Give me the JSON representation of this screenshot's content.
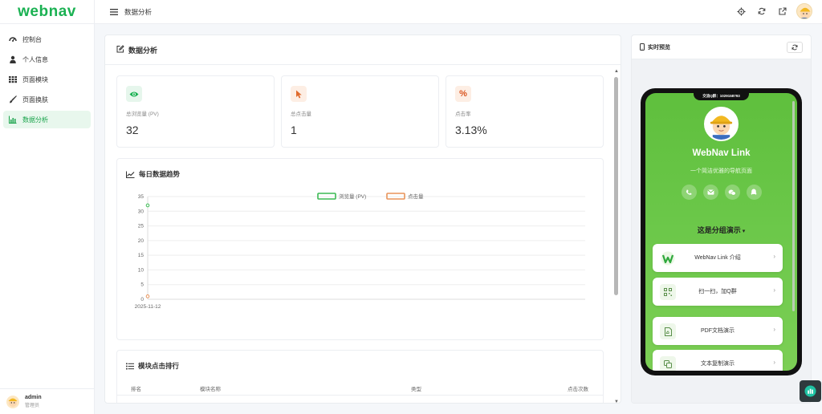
{
  "brand": {
    "logo_text": "webnav",
    "logo_color": "#1ab152"
  },
  "sidebar": {
    "items": [
      {
        "label": "控制台",
        "icon": "dashboard-icon"
      },
      {
        "label": "个人信息",
        "icon": "user-icon"
      },
      {
        "label": "页面模块",
        "icon": "grid-icon"
      },
      {
        "label": "页面换肤",
        "icon": "brush-icon"
      },
      {
        "label": "数据分析",
        "icon": "chart-icon",
        "active": true
      }
    ],
    "user": {
      "name": "admin",
      "role": "管理员"
    }
  },
  "header": {
    "title": "数据分析",
    "actions": [
      "settings-icon",
      "refresh-icon",
      "external-link-icon",
      "avatar"
    ]
  },
  "main": {
    "title": "数据分析",
    "stats": [
      {
        "label": "总浏览量 (PV)",
        "value": "32",
        "icon": "eye-icon",
        "color": "#1ab152",
        "bg": "#e6f6ec"
      },
      {
        "label": "总点击量",
        "value": "1",
        "icon": "pointer-icon",
        "color": "#e06b2d",
        "bg": "#fdeee4"
      },
      {
        "label": "点击率",
        "value": "3.13%",
        "icon": "percent-icon",
        "color": "#d9541e",
        "bg": "#fdeee4"
      }
    ],
    "trend_title": "每日数据趋势",
    "rank": {
      "title": "模块点击排行",
      "columns": [
        "排名",
        "模块名称",
        "类型",
        "点击次数"
      ]
    }
  },
  "chart_data": {
    "type": "line",
    "x": [
      "2025-11-12"
    ],
    "series": [
      {
        "name": "浏览量 (PV)",
        "values": [
          32
        ],
        "color": "#3cba54"
      },
      {
        "name": "点击量",
        "values": [
          1
        ],
        "color": "#e8945a"
      }
    ],
    "ylim": [
      0,
      35
    ],
    "yticks": [
      "35",
      "30",
      "25",
      "20",
      "15",
      "10",
      "5",
      "0"
    ],
    "legend": "top-center",
    "grid": true
  },
  "preview": {
    "title": "实时预览",
    "notch_text": "交流Q群：1029158793",
    "profile": {
      "name": "WebNav Link",
      "desc": "一个简洁优雅的导航页面"
    },
    "socials": [
      "phone-icon",
      "email-icon",
      "wechat-icon",
      "qq-icon"
    ],
    "group_title": "这是分组演示",
    "links": [
      {
        "label": "WebNav Link 介绍",
        "icon": "webnav-logo-icon"
      },
      {
        "label": "扫一扫，加Q群",
        "icon": "qrcode-icon"
      },
      {
        "label": "PDF文档演示",
        "icon": "pdf-icon"
      },
      {
        "label": "文本复制演示",
        "icon": "copy-icon"
      }
    ],
    "link_arrow": "›"
  }
}
